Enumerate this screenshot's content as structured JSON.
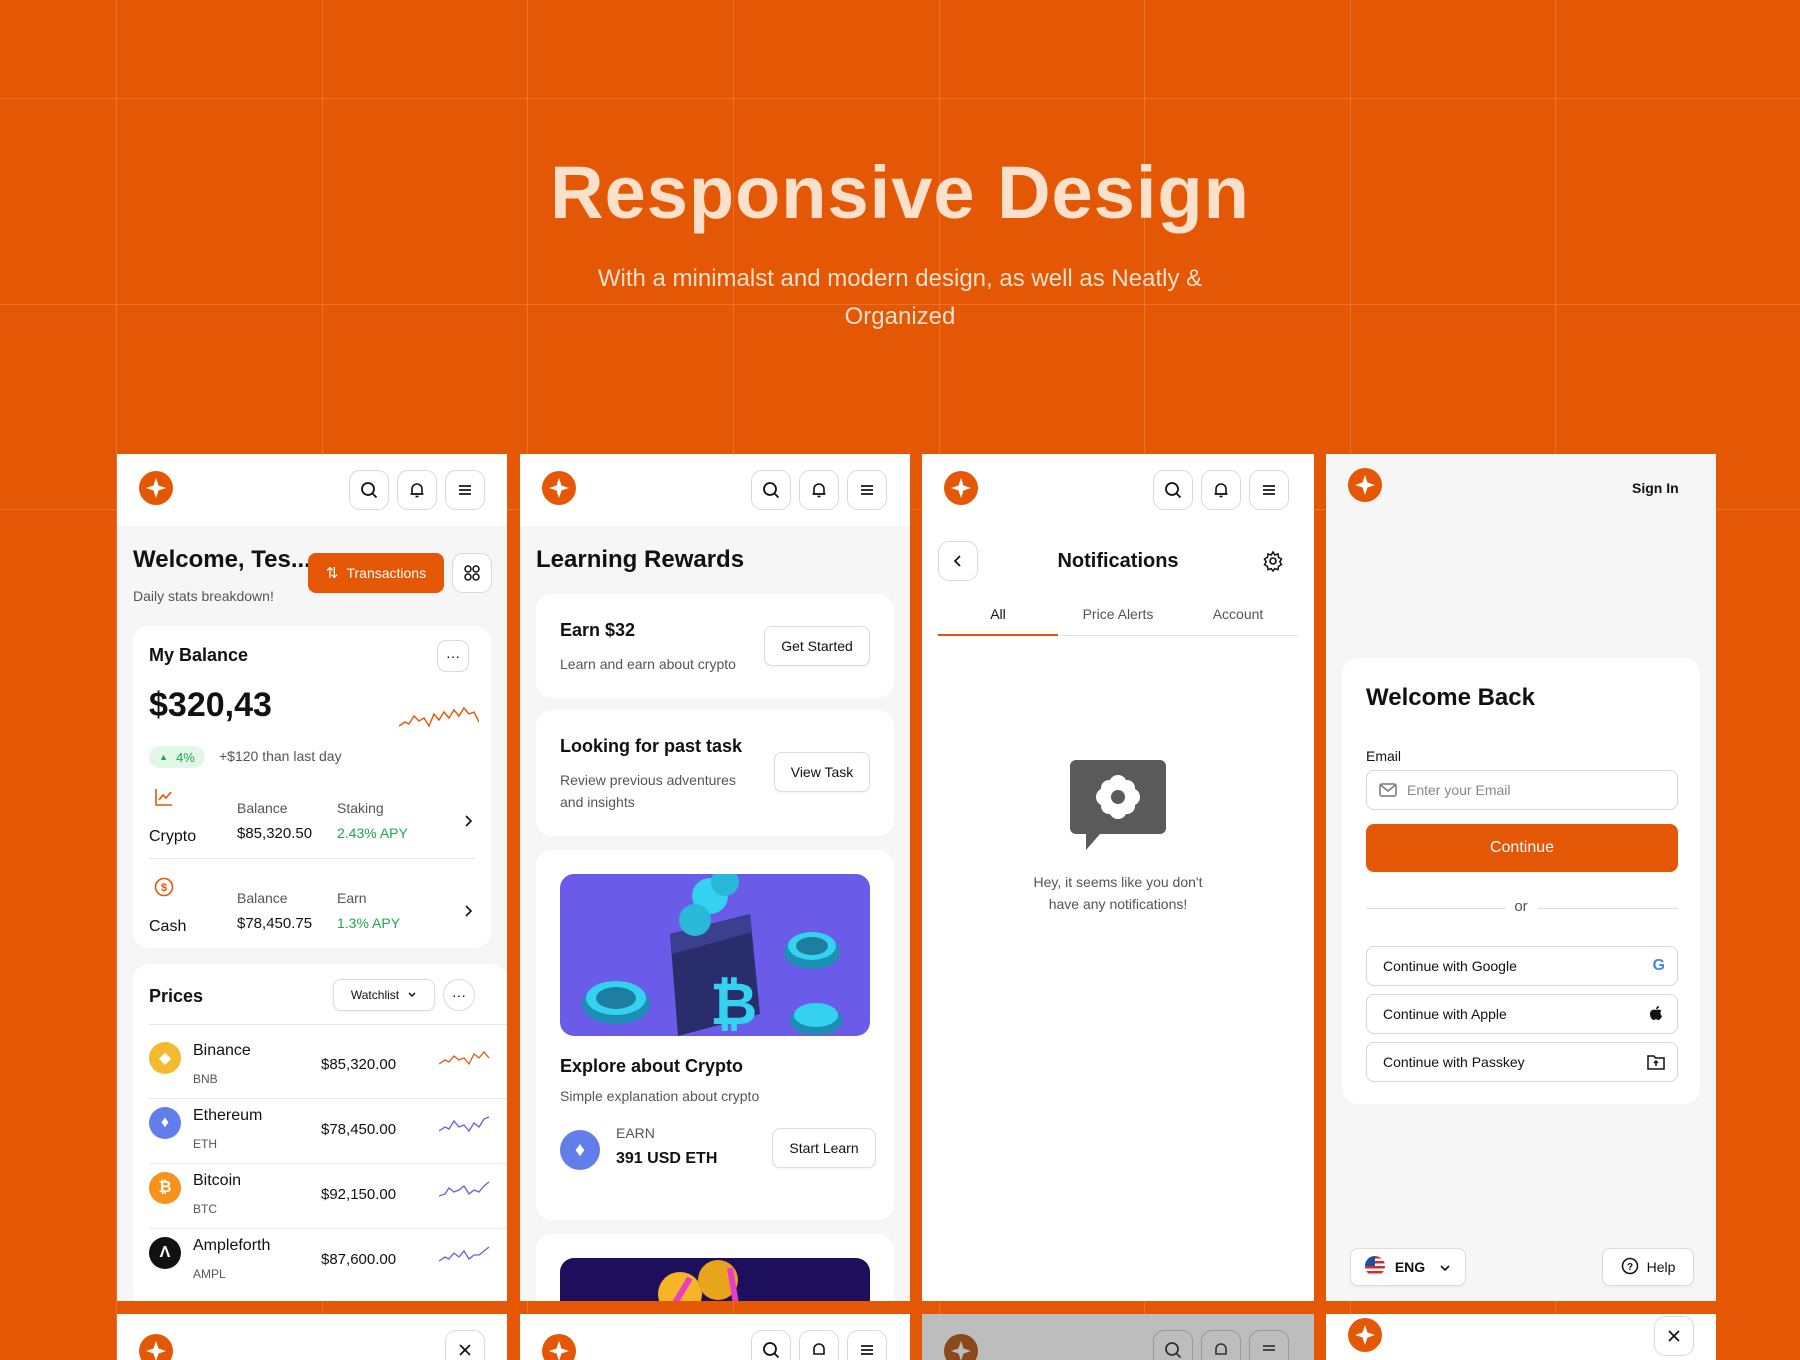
{
  "hero": {
    "title": "Responsive Design",
    "subtitle": "With a minimalst and modern design, as well as Neatly & Organized"
  },
  "colors": {
    "brand": "#E35705",
    "positive": "#1BA94C",
    "background": "#E35705"
  },
  "dashboard": {
    "welcome": "Welcome, Tes...",
    "subtitle": "Daily stats breakdown!",
    "transactions_label": "Transactions",
    "balance_title": "My Balance",
    "balance_value": "$320,43",
    "change_pct": "4%",
    "change_text": "+$120 than last day",
    "accounts": [
      {
        "name": "Crypto",
        "col1_label": "Balance",
        "col1_value": "$85,320.50",
        "col2_label": "Staking",
        "col2_value": "2.43% APY",
        "icon": "chart-icon"
      },
      {
        "name": "Cash",
        "col1_label": "Balance",
        "col1_value": "$78,450.75",
        "col2_label": "Earn",
        "col2_value": "1.3% APY",
        "icon": "dollar-coin-icon"
      }
    ],
    "prices_title": "Prices",
    "watchlist_label": "Watchlist",
    "coins": [
      {
        "name": "Binance",
        "symbol": "BNB",
        "price": "$85,320.00",
        "color": "#F3BA2F",
        "sparkline_color": "#E35705",
        "glyph": "◆"
      },
      {
        "name": "Ethereum",
        "symbol": "ETH",
        "price": "$78,450.00",
        "color": "#627EEA",
        "sparkline_color": "#6B5BE0",
        "glyph": "♦"
      },
      {
        "name": "Bitcoin",
        "symbol": "BTC",
        "price": "$92,150.00",
        "color": "#F7931A",
        "sparkline_color": "#6B5BE0",
        "glyph": "₿"
      },
      {
        "name": "Ampleforth",
        "symbol": "AMPL",
        "price": "$87,600.00",
        "color": "#111111",
        "sparkline_color": "#6B5BE0",
        "glyph": "Λ"
      }
    ]
  },
  "rewards": {
    "title": "Learning Rewards",
    "earn_title": "Earn $32",
    "earn_desc": "Learn and earn about crypto",
    "get_started": "Get Started",
    "past_title": "Looking for past task",
    "past_desc_1": "Review previous adventures",
    "past_desc_2": "and insights",
    "view_task": "View Task",
    "explore_title": "Explore about Crypto",
    "explore_desc": "Simple explanation about crypto",
    "earn_label": "EARN",
    "earn_value": "391 USD ETH",
    "start_learn": "Start Learn"
  },
  "notifications": {
    "title": "Notifications",
    "tabs": [
      "All",
      "Price Alerts",
      "Account"
    ],
    "active_tab": "All",
    "empty_line1": "Hey, it seems like you don't",
    "empty_line2": "have any notifications!"
  },
  "signin": {
    "sign_in_link": "Sign In",
    "title": "Welcome Back",
    "email_label": "Email",
    "email_placeholder": "Enter your Email",
    "continue": "Continue",
    "or": "or",
    "google": "Continue with Google",
    "apple": "Continue with Apple",
    "passkey": "Continue with Passkey",
    "language": "ENG",
    "help": "Help"
  }
}
